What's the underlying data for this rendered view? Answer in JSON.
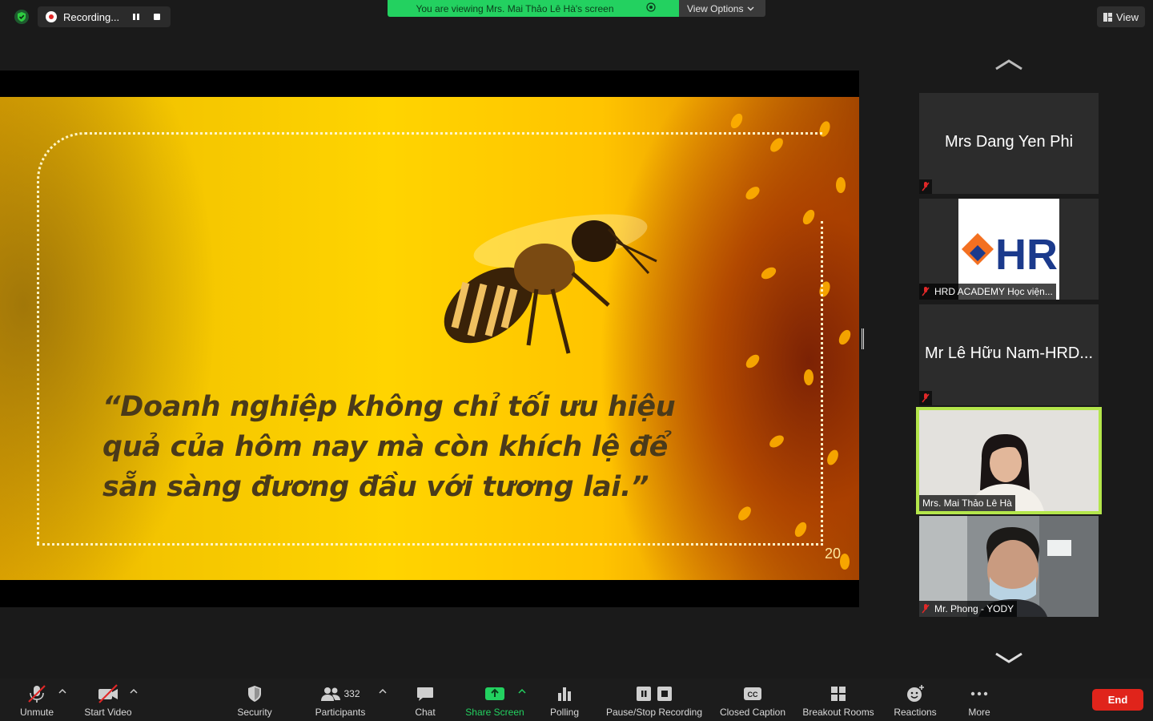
{
  "top_bar": {
    "recording_label": "Recording...",
    "viewing_banner": "You are viewing Mrs. Mai Thảo Lê Hà's screen",
    "view_options_label": "View Options",
    "view_label": "View",
    "colors": {
      "banner": "#23d160",
      "recording_dot": "#e02828"
    }
  },
  "slide": {
    "quote": "“Doanh nghiệp không chỉ tối ưu hiệu quả của hôm nay mà còn khích lệ để sẵn sàng đương đầu với tương lai.”",
    "page_number": "20"
  },
  "gallery": {
    "tiles": [
      {
        "name": "Mrs Dang Yen Phi",
        "muted": true
      },
      {
        "name": "HRD ACADEMY Học viện...",
        "logo_text": "HRD",
        "muted": true
      },
      {
        "name": "Mr Lê Hữu Nam-HRD...",
        "muted": true
      },
      {
        "name": "Mrs. Mai Thảo Lê Hà",
        "muted": false,
        "active_speaker": true
      },
      {
        "name": "Mr. Phong - YODY",
        "muted": true
      }
    ],
    "active_border_color": "#b4e64b"
  },
  "toolbar": {
    "unmute": "Unmute",
    "start_video": "Start Video",
    "security": "Security",
    "participants": "Participants",
    "participants_count": "332",
    "chat": "Chat",
    "share_screen": "Share Screen",
    "polling": "Polling",
    "pause_stop_recording": "Pause/Stop Recording",
    "closed_caption": "Closed Caption",
    "breakout_rooms": "Breakout Rooms",
    "reactions": "Reactions",
    "more": "More",
    "end": "End",
    "colors": {
      "share_green": "#23d160",
      "end_red": "#e0241b"
    }
  }
}
